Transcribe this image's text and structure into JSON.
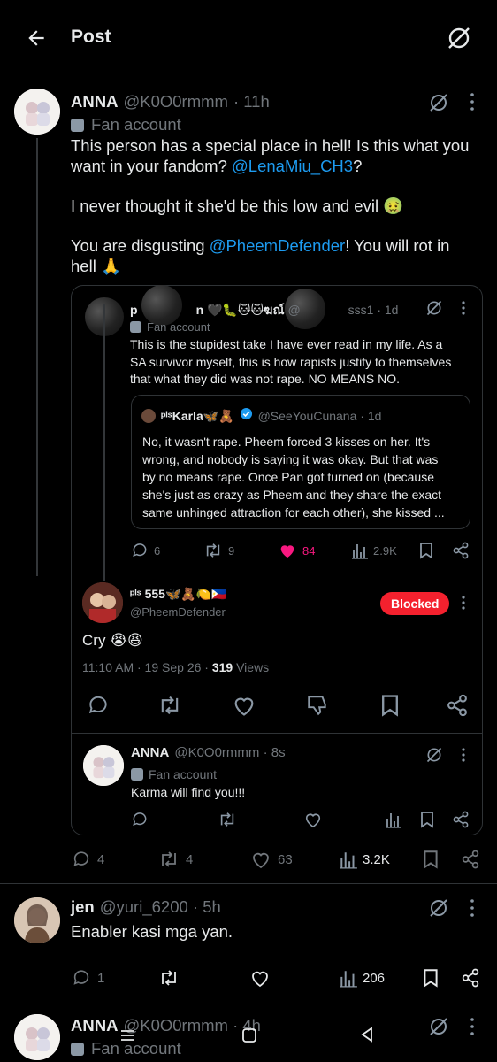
{
  "header": {
    "title": "Post"
  },
  "main_post": {
    "name": "ANNA",
    "handle": "@K0O0rmmm",
    "time": "· 11h",
    "badge": "Fan account",
    "line1a": "This person has a special place in hell! Is this what you",
    "line1b": "want in your fandom? ",
    "mention1": "@LenaMiu_CH3",
    "line1c": "?",
    "line2": "I never thought it she'd be this low and evil 🤢",
    "line3a": "You are disgusting ",
    "mention2": "@PheemDefender",
    "line3b": "! You will rot in",
    "line3c": "hell 🙏"
  },
  "quote1": {
    "name": "p",
    "name_tail": "n 🖤🐛🐱🐱ฆณ์",
    "handle_tail": "@",
    "handle_end": "sss1 · 1d",
    "badge": "Fan account",
    "text": [
      "This is the stupidest take I have ever read in my life. As a",
      "SA survivor myself, this is how rapists justify to themselves",
      "that what they did was not rape. NO MEANS NO."
    ],
    "stats": {
      "replies": "6",
      "reposts": "9",
      "likes": "84",
      "views": "2.9K"
    }
  },
  "quote2": {
    "name": "ᵖˡˢKarla🦋🧸",
    "handle": "@SeeYouCunana · 1d",
    "text": [
      "No, it wasn't rape. Pheem forced 3 kisses on her. It's",
      "wrong, and nobody is saying it was okay. But that was",
      "by no means rape. Once Pan got turned on (because",
      "she's just as crazy as Pheem and they share the exact",
      "same unhinged attraction for each other), she kissed ..."
    ]
  },
  "blocked_post": {
    "name": "ᵖˡˢ 555🦋🧸🍋🇵🇭",
    "handle": "@PheemDefender",
    "blocked_label": "Blocked",
    "text": "Cry 😭😆",
    "time": "11:10 AM · 19 Sep 26 · ",
    "views_count": "319",
    "views_label": " Views"
  },
  "reply_card": {
    "name": "ANNA",
    "handle": "@K0O0rmmm · 8s",
    "badge": "Fan account",
    "text": "Karma will find you!!!"
  },
  "main_stats": {
    "replies": "4",
    "reposts": "4",
    "likes": "63",
    "views": "3.2K"
  },
  "jen_post": {
    "name": "jen",
    "handle": "@yuri_6200 · 5h",
    "text": "Enabler kasi mga yan.",
    "stats": {
      "replies": "1",
      "views": "206"
    }
  },
  "bottom_post": {
    "name": "ANNA",
    "handle": "@K0O0rmmm · 4h",
    "badge": "Fan account"
  }
}
